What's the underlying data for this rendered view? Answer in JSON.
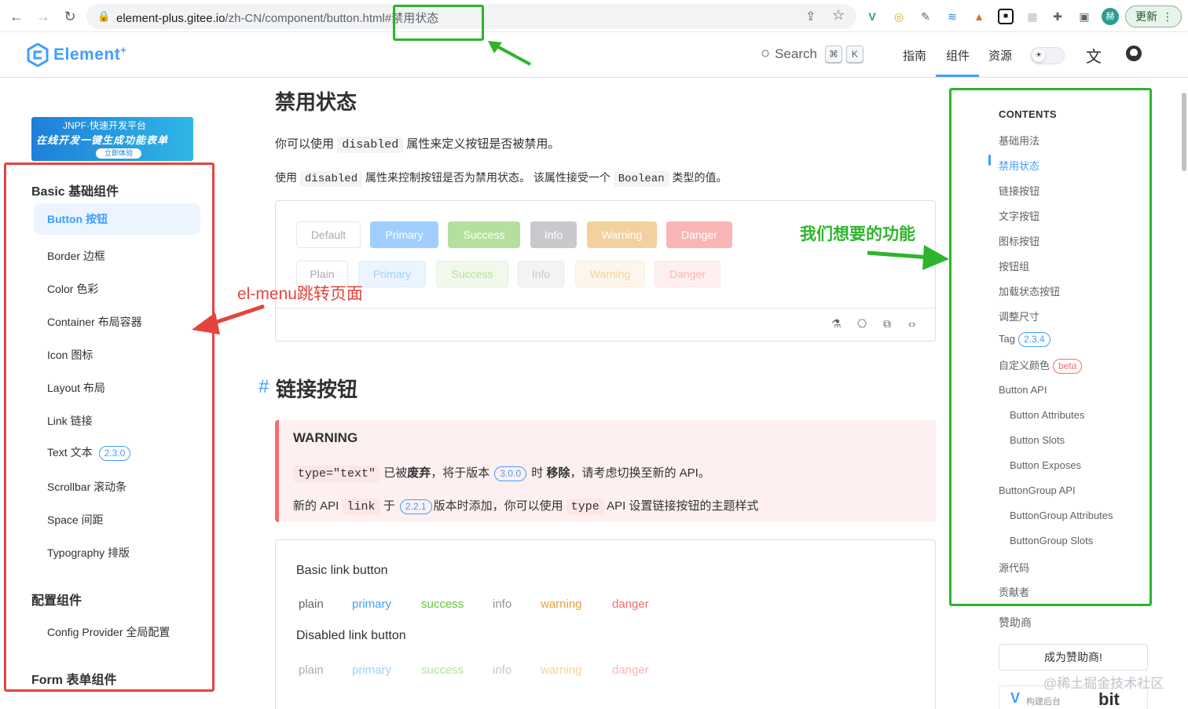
{
  "browser": {
    "url_host": "element-plus.gitee.io",
    "url_path": "/zh-CN/component/button.html#禁用状态",
    "update_label": "更新",
    "avatar_letter": "赫"
  },
  "header": {
    "logo_text": "Element",
    "logo_sup": "+",
    "search_label": "Search",
    "kbd_cmd": "⌘",
    "kbd_k": "K",
    "nav": [
      "指南",
      "组件",
      "资源"
    ],
    "active_nav_index": 1
  },
  "sidebar": {
    "banner_line1": "JNPF·快速开发平台",
    "banner_line2": "在线开发一键生成功能表单",
    "banner_cta": "立即体验",
    "section1": "Basic 基础组件",
    "items": [
      {
        "label": "Button 按钮",
        "active": true
      },
      {
        "label": "Border 边框"
      },
      {
        "label": "Color 色彩"
      },
      {
        "label": "Container 布局容器"
      },
      {
        "label": "Icon 图标"
      },
      {
        "label": "Layout 布局"
      },
      {
        "label": "Link 链接"
      },
      {
        "label": "Text 文本",
        "badge": "2.3.0"
      },
      {
        "label": "Scrollbar 滚动条"
      },
      {
        "label": "Space 间距"
      },
      {
        "label": "Typography 排版"
      }
    ],
    "section2": "配置组件",
    "config_item": "Config Provider 全局配置",
    "section3": "Form 表单组件"
  },
  "main": {
    "title": "禁用状态",
    "p1_pre": "你可以使用",
    "p1_code": "disabled",
    "p1_post": "属性来定义按钮是否被禁用。",
    "p2_pre": "使用",
    "p2_code": "disabled",
    "p2_mid": "属性来控制按钮是否为禁用状态。 该属性接受一个",
    "p2_code2": "Boolean",
    "p2_post": "类型的值。",
    "buttons_row1": [
      "Default",
      "Primary",
      "Success",
      "Info",
      "Warning",
      "Danger"
    ],
    "buttons_row2": [
      "Plain",
      "Primary",
      "Success",
      "Info",
      "Warning",
      "Danger"
    ],
    "h2_hash": "#",
    "h2": "链接按钮",
    "warning": {
      "title": "WARNING",
      "l1_code": "type=\"text\"",
      "l1_a": "已被",
      "l1_b": "废弃",
      "l1_c": "，将于版本",
      "l1_badge": "3.0.0",
      "l1_d": "时",
      "l1_e": "移除",
      "l1_f": "，请考虑切换至新的 API。",
      "l2_a": "新的 API",
      "l2_code": "link",
      "l2_b": "于",
      "l2_badge": "2.2.1",
      "l2_c": "版本时添加，你可以使用",
      "l2_code2": "type",
      "l2_d": "API 设置链接按钮的主题样式"
    },
    "basic_link_title": "Basic link button",
    "disabled_link_title": "Disabled link button",
    "links": [
      "plain",
      "primary",
      "success",
      "info",
      "warning",
      "danger"
    ]
  },
  "toc": {
    "title": "CONTENTS",
    "items": [
      {
        "label": "基础用法"
      },
      {
        "label": "禁用状态",
        "active": true
      },
      {
        "label": "链接按钮"
      },
      {
        "label": "文字按钮"
      },
      {
        "label": "图标按钮"
      },
      {
        "label": "按钮组"
      },
      {
        "label": "加载状态按钮"
      },
      {
        "label": "调整尺寸"
      },
      {
        "label": "Tag",
        "badge": "2.3.4"
      },
      {
        "label": "自定义颜色",
        "badge": "beta",
        "badge_red": true
      },
      {
        "label": "Button API"
      },
      {
        "label": "Button Attributes",
        "indent": true
      },
      {
        "label": "Button Slots",
        "indent": true
      },
      {
        "label": "Button Exposes",
        "indent": true
      },
      {
        "label": "ButtonGroup API"
      },
      {
        "label": "ButtonGroup Attributes",
        "indent": true
      },
      {
        "label": "ButtonGroup Slots",
        "indent": true
      },
      {
        "label": "源代码"
      },
      {
        "label": "贡献者"
      }
    ],
    "sponsor_label": "赞助商",
    "sponsor_button": "成为赞助商!",
    "sponsor_logo1": "构建后台",
    "sponsor_logo2": "bit"
  },
  "annotations": {
    "green_text": "我们想要的功能",
    "red_text": "el-menu跳转页面"
  },
  "watermark": "@稀土掘金技术社区",
  "colors": {
    "primary": "#409eff",
    "success": "#67c23a",
    "info": "#909399",
    "warning": "#e6a23c",
    "danger": "#f56c6c",
    "annot_green": "#2cb52c",
    "annot_red": "#e5443d"
  }
}
